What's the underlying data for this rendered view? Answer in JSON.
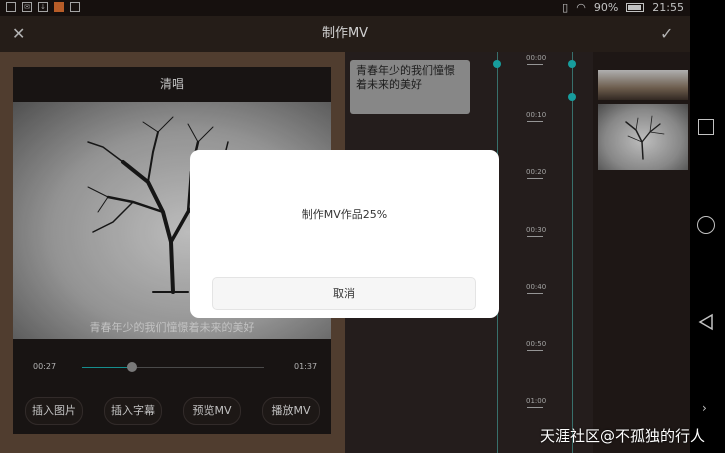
{
  "status_bar": {
    "battery_percent": "90%",
    "time": "21:55",
    "left_icons": [
      "image-icon",
      "mail-icon",
      "download-icon",
      "app-icon",
      "keyboard-icon"
    ],
    "right_icons": [
      "vibrate-icon",
      "wifi-icon",
      "battery-icon"
    ]
  },
  "header": {
    "title": "制作MV"
  },
  "preview": {
    "title": "清唱",
    "caption": "青春年少的我们憧憬着未来的美好",
    "current_time": "00:27",
    "total_time": "01:37",
    "progress": 0.28
  },
  "actions": [
    {
      "label": "插入图片"
    },
    {
      "label": "插入字幕"
    },
    {
      "label": "预览MV"
    },
    {
      "label": "播放MV"
    }
  ],
  "timeline": {
    "lyric": "青春年少的我们憧憬着未来的美好",
    "ticks": [
      "00:00",
      "00:10",
      "00:20",
      "00:30",
      "00:40",
      "00:50",
      "01:00"
    ]
  },
  "dialog": {
    "message": "制作MV作品25%",
    "cancel_label": "取消",
    "progress_percent": 25
  },
  "watermark": "天涯社区@不孤独的行人",
  "colors": {
    "accent": "#1bb3b3",
    "background": "#3a2a22"
  }
}
